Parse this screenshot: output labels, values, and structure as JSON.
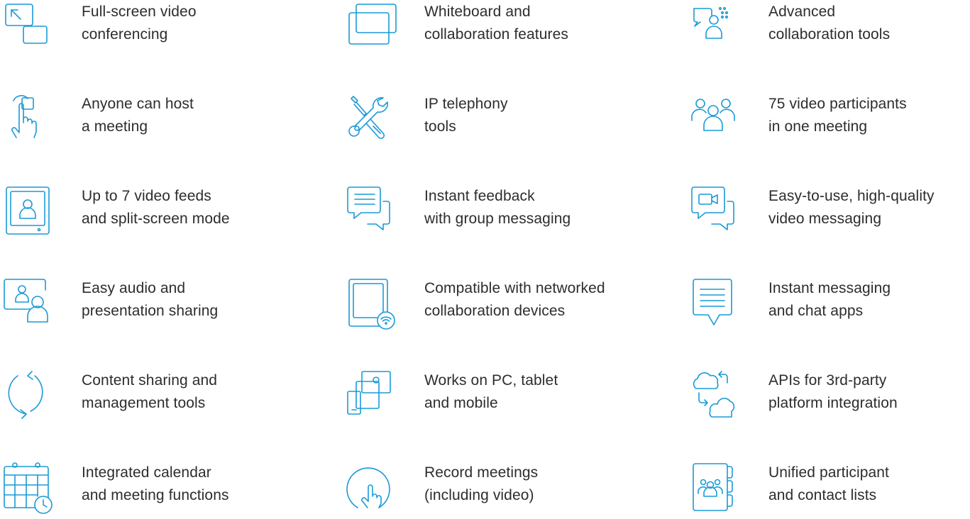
{
  "colors": {
    "accent": "#1a9ad6",
    "text": "#2d2d2d"
  },
  "features": [
    {
      "icon": "fullscreen-icon",
      "line1": "Full-screen video",
      "line2": "conferencing"
    },
    {
      "icon": "whiteboard-icon",
      "line1": "Whiteboard and",
      "line2": "collaboration features"
    },
    {
      "icon": "collaboration-icon",
      "line1": "Advanced",
      "line2": "collaboration tools"
    },
    {
      "icon": "hand-pointer-icon",
      "line1": "Anyone can host",
      "line2": "a meeting"
    },
    {
      "icon": "tools-icon",
      "line1": "IP telephony",
      "line2": "tools"
    },
    {
      "icon": "group-icon",
      "line1": "75 video participants",
      "line2": "in one meeting"
    },
    {
      "icon": "video-feed-icon",
      "line1": "Up to 7 video feeds",
      "line2": "and split-screen mode"
    },
    {
      "icon": "chat-bubbles-icon",
      "line1": "Instant feedback",
      "line2": "with group messaging"
    },
    {
      "icon": "video-message-icon",
      "line1": "Easy-to-use, high-quality",
      "line2": "video messaging"
    },
    {
      "icon": "presentation-share-icon",
      "line1": "Easy audio and",
      "line2": "presentation sharing"
    },
    {
      "icon": "networked-device-icon",
      "line1": "Compatible with networked",
      "line2": "collaboration devices"
    },
    {
      "icon": "chat-icon",
      "line1": "Instant messaging",
      "line2": "and chat apps"
    },
    {
      "icon": "sync-arrows-icon",
      "line1": "Content sharing and",
      "line2": "management tools"
    },
    {
      "icon": "multi-device-icon",
      "line1": "Works on PC, tablet",
      "line2": "and mobile"
    },
    {
      "icon": "cloud-sync-icon",
      "line1": "APIs for 3rd-party",
      "line2": "platform integration"
    },
    {
      "icon": "calendar-icon",
      "line1": "Integrated calendar",
      "line2": "and meeting functions"
    },
    {
      "icon": "record-touch-icon",
      "line1": "Record meetings",
      "line2": "(including video)"
    },
    {
      "icon": "contact-book-icon",
      "line1": "Unified participant",
      "line2": "and contact lists"
    }
  ]
}
